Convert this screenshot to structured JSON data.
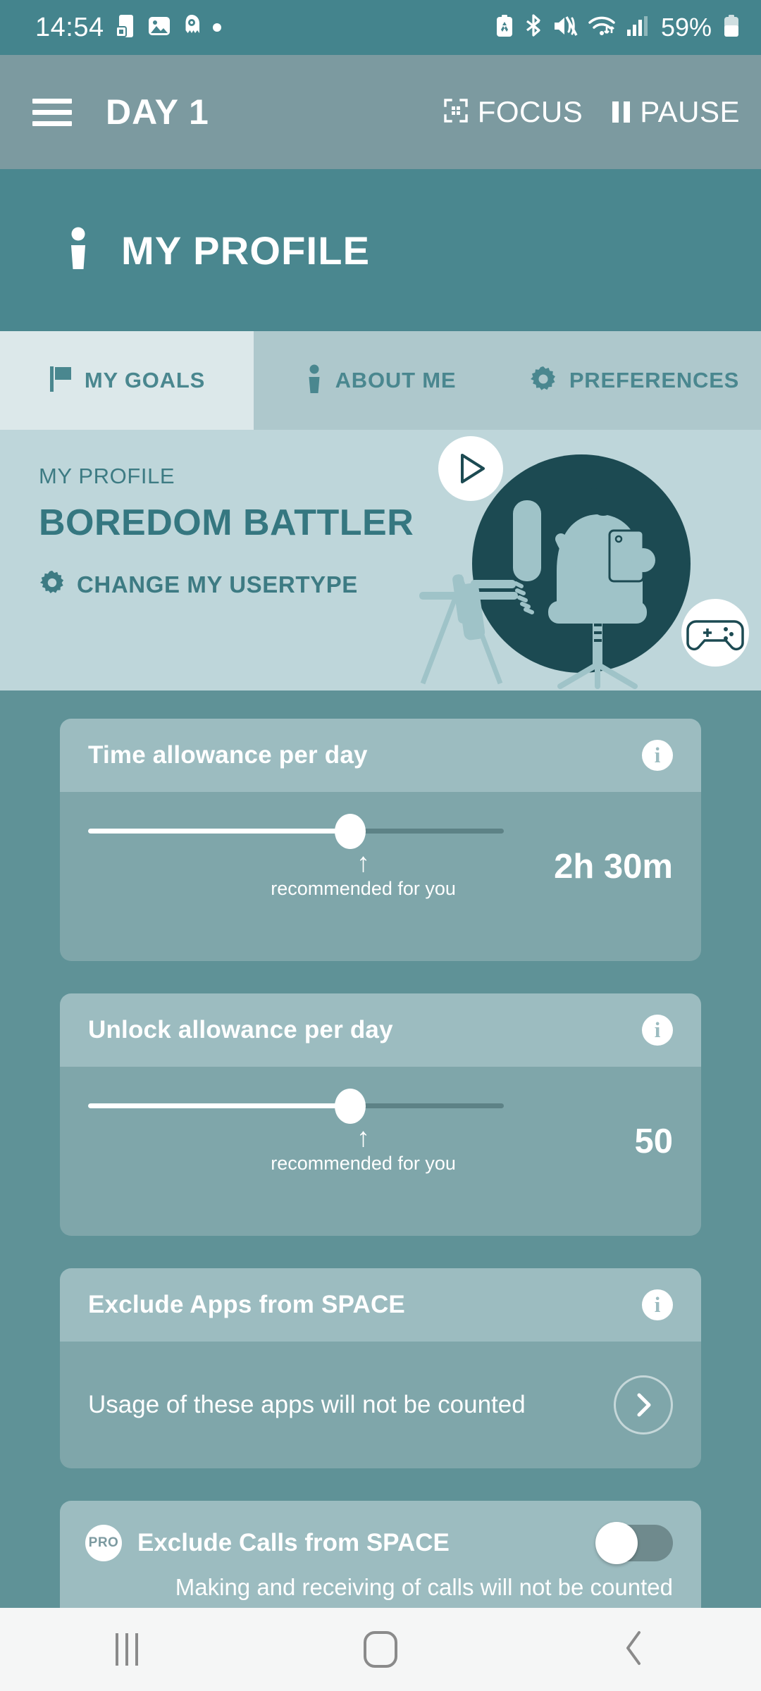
{
  "status_bar": {
    "time": "14:54",
    "battery_percent": "59%",
    "left_icons": [
      "phone-lock-icon",
      "photo-icon",
      "app-notification-icon",
      "dot-indicator-icon"
    ],
    "right_icons": [
      "battery-saver-icon",
      "bluetooth-icon",
      "mute-icon",
      "wifi-icon",
      "signal-icon",
      "battery-icon"
    ]
  },
  "app_bar": {
    "menu_icon": "hamburger-menu-icon",
    "day_title": "DAY 1",
    "focus_label": "FOCUS",
    "focus_icon": "focus-frame-icon",
    "pause_label": "PAUSE",
    "pause_icon": "pause-icon"
  },
  "profile_banner": {
    "title": "MY PROFILE",
    "icon": "person-icon"
  },
  "tabs": [
    {
      "label": "MY GOALS",
      "icon": "flag-icon",
      "active": true
    },
    {
      "label": "ABOUT ME",
      "icon": "person-icon",
      "active": false
    },
    {
      "label": "PREFERENCES",
      "icon": "gear-icon",
      "active": false
    }
  ],
  "profile_card": {
    "kicker": "MY PROFILE",
    "usertype": "BOREDOM BATTLER",
    "change_label": "CHANGE MY USERTYPE",
    "change_icon": "gear-icon",
    "illustration": "person-on-office-chair-with-phone",
    "badge_play_icon": "play-icon",
    "badge_game_icon": "gamepad-icon"
  },
  "settings": {
    "time_allowance": {
      "title": "Time allowance per day",
      "info_icon": "info-icon",
      "value": "2h 30m",
      "slider_percent": 63,
      "recommended_percent": 63,
      "recommended_label": "recommended for you",
      "recommended_arrow": "↑"
    },
    "unlock_allowance": {
      "title": "Unlock allowance per day",
      "info_icon": "info-icon",
      "value": "50",
      "slider_percent": 63,
      "recommended_percent": 63,
      "recommended_label": "recommended for you",
      "recommended_arrow": "↑"
    },
    "exclude_apps": {
      "title": "Exclude Apps from SPACE",
      "info_icon": "info-icon",
      "description": "Usage of these apps will not be counted",
      "chevron_icon": "chevron-right-icon"
    },
    "exclude_calls": {
      "badge": "PRO",
      "title": "Exclude Calls from SPACE",
      "description": "Making and receiving of calls will not be counted",
      "toggle_on": false
    }
  },
  "nav_bar": {
    "recents_icon": "recents-icon",
    "home_icon": "home-icon",
    "back_icon": "back-icon"
  },
  "colors": {
    "status_bar": "#44848d",
    "app_bar": "#7c9aa0",
    "banner": "#4a878f",
    "tab_active": "#dce8ea",
    "tab_inactive": "#aec8cc",
    "accent": "#357780",
    "background": "#5f9297",
    "card_head": "#9cbcc0",
    "card_body": "#7fa6aa"
  }
}
